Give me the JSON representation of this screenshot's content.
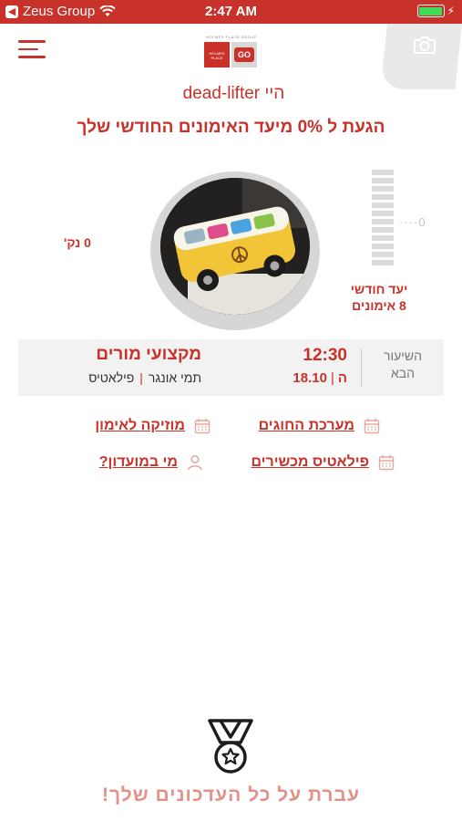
{
  "status_bar": {
    "carrier": "Zeus Group",
    "time": "2:47 AM"
  },
  "header": {
    "logo_tagline": "HOLMES PLACE GROUP",
    "logo_left_text": "HOLMES PLACE",
    "logo_right_text": "GO"
  },
  "greeting": {
    "prefix": "היי",
    "name": "dead-lifter"
  },
  "progress": {
    "title": "הגעת ל 0% מיעד האימונים החודשי שלך",
    "points": "0 נק'",
    "current_marker": "0",
    "goal_line1": "יעד חודשי",
    "goal_line2": "8 אימונים",
    "goal_fill": 0
  },
  "next_class": {
    "label_line1": "השיעור",
    "label_line2": "הבא",
    "time": "12:30",
    "day": "ה",
    "date": "18.10",
    "title": "מקצועי מורים",
    "instructor": "תמי אונגר",
    "category": "פילאטיס"
  },
  "links": {
    "schedule": "מערכת החוגים",
    "music": "מוזיקה לאימון",
    "pilates": "פילאטיס מכשירים",
    "club": "מי במועדון?"
  },
  "footer": {
    "updates": "עברת על כל העדכונים שלך!"
  },
  "colors": {
    "accent": "#c8322a",
    "muted_accent": "#e29288",
    "card_bg": "#f2f2f2"
  }
}
